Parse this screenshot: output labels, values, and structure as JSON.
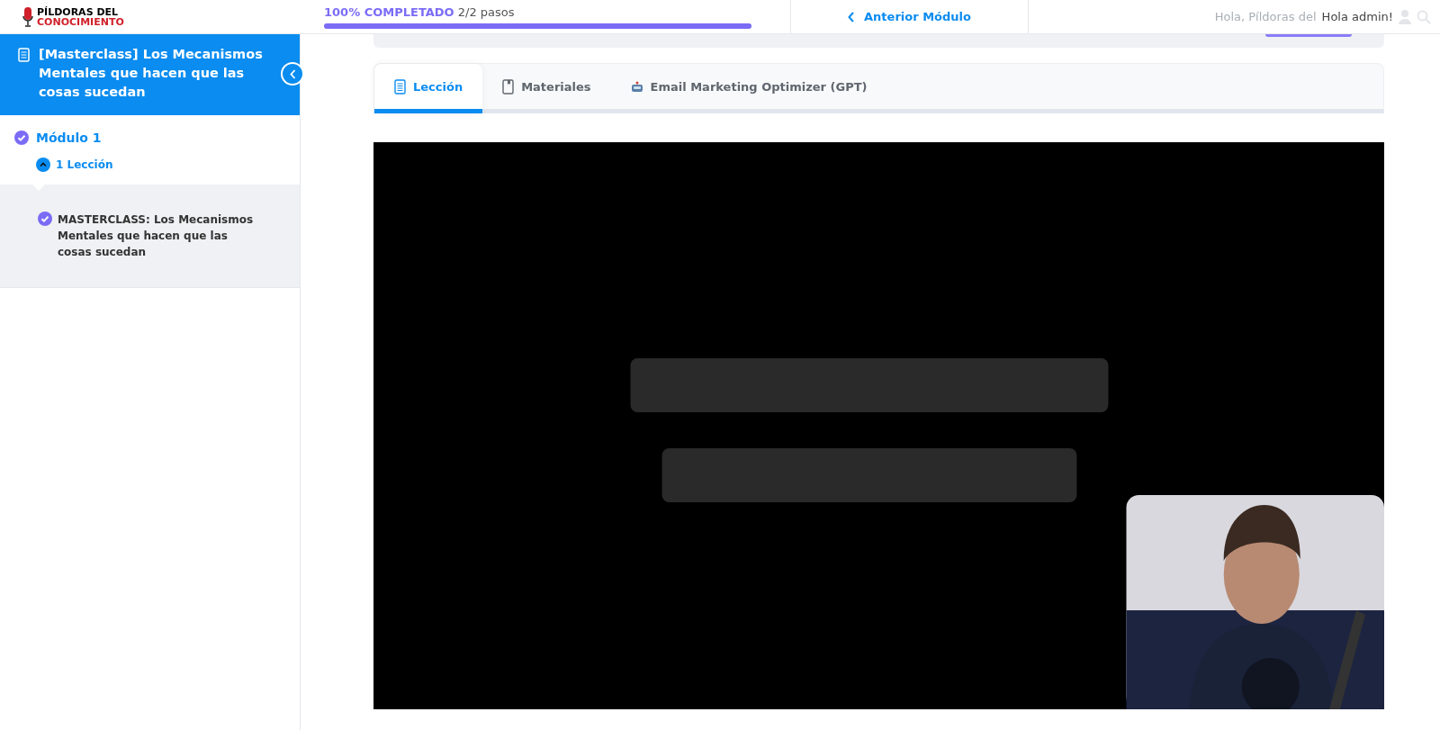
{
  "header": {
    "logo": {
      "line_1": "PÍLDORAS DEL",
      "line_2": "CONOCIMIENTO"
    },
    "progress": {
      "label": "100% COMPLETADO",
      "steps": "2/2 pasos",
      "level": 1
    },
    "prev_button": "Anterior Módulo",
    "greeting_faded": "Hola, Píldoras del",
    "greeting": "Hola admin!"
  },
  "sidebar": {
    "course_title": "[Masterclass] Los Mecanismos Mentales que hacen que las cosas sucedan",
    "modules": [
      {
        "title": "Módulo 1",
        "completed": true,
        "lessons_toggle": "1 Lección",
        "expanded": true,
        "lessons": [
          {
            "title": "MASTERCLASS: Los Mecanismos Mentales que hacen que las cosas sucedan",
            "completed": true
          }
        ]
      }
    ]
  },
  "tabs": [
    {
      "label": "Lección",
      "selected": true
    },
    {
      "label": "Materiales",
      "selected": false
    },
    {
      "label": "Email Marketing Optimizer (GPT)",
      "selected": false
    }
  ]
}
